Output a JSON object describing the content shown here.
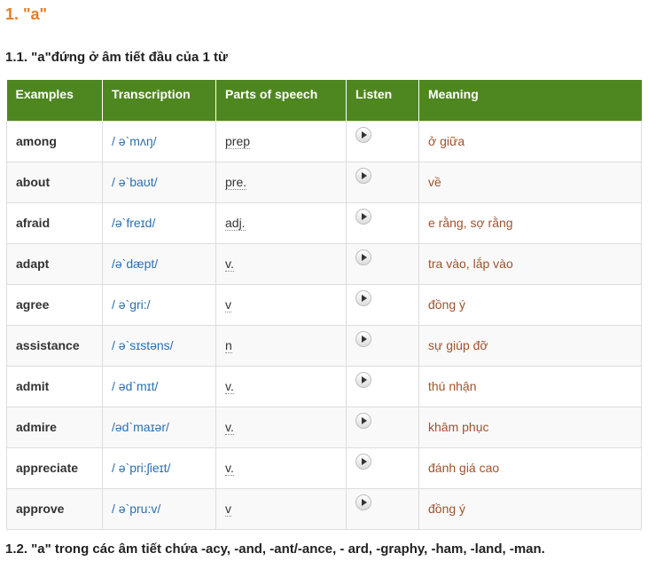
{
  "heading1": "1. \"a\"",
  "heading2": "1.1. \"a\"đứng ở âm tiết đầu của 1 từ",
  "heading3": "1.2. \"a\" trong các âm tiết chứa -acy, -and, -ant/-ance, - ard, -graphy, -ham, -land, -man.",
  "table": {
    "headers": [
      "Examples",
      "Transcription",
      "Parts of speech",
      "Listen",
      "Meaning"
    ],
    "listen_icon": "play-audio-icon",
    "rows": [
      {
        "word": "among",
        "ipa": "/ ə`mʌŋ/",
        "pos": "prep",
        "meaning": "ở giữa"
      },
      {
        "word": "about",
        "ipa": "/ ə`baʊt/",
        "pos": "pre.",
        "meaning": "về"
      },
      {
        "word": "afraid",
        "ipa": "/ə`freɪd/",
        "pos": "adj.",
        "meaning": "e rằng, sợ rằng"
      },
      {
        "word": "adapt",
        "ipa": "/ə`dæpt/",
        "pos": "v.",
        "meaning": "tra vào, lắp vào"
      },
      {
        "word": "agree",
        "ipa": "/ ə`gri:/",
        "pos": "v",
        "meaning": "đồng ý"
      },
      {
        "word": "assistance",
        "ipa": "/ ə`sɪstəns/",
        "pos": "n",
        "meaning": "sự giúp đỡ"
      },
      {
        "word": "admit",
        "ipa": "/ əd`mɪt/",
        "pos": "v.",
        "meaning": "thú nhận"
      },
      {
        "word": "admire",
        "ipa": "/əd`maɪər/",
        "pos": "v.",
        "meaning": "khâm phục"
      },
      {
        "word": "appreciate",
        "ipa": "/ ə`pri:ʃieɪt/",
        "pos": "v.",
        "meaning": "đánh giá cao"
      },
      {
        "word": "approve",
        "ipa": "/ ə`pru:v/",
        "pos": "v",
        "meaning": "đồng ý"
      }
    ]
  },
  "colors": {
    "heading_accent": "#e67e22",
    "table_header_bg": "#4e8620",
    "transcription": "#2a6fb0",
    "meaning": "#a0522d"
  }
}
